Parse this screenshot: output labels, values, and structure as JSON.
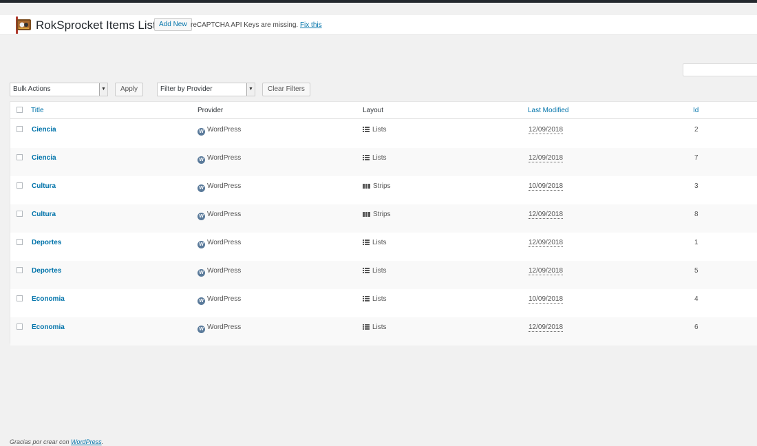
{
  "header": {
    "title": "RokSprocket Items List",
    "add_new_label": "Add New",
    "notice_text": "reCAPTCHA API Keys are missing.",
    "notice_link": "Fix this"
  },
  "toolbar": {
    "bulk_actions": "Bulk Actions",
    "apply_label": "Apply",
    "filter_provider": "Filter by Provider",
    "clear_filters_label": "Clear Filters"
  },
  "table": {
    "columns": {
      "title": "Title",
      "provider": "Provider",
      "layout": "Layout",
      "modified": "Last Modified",
      "id": "Id"
    },
    "rows": [
      {
        "title": "Ciencia",
        "provider": "WordPress",
        "layout": "Lists",
        "layout_icon": "list-icon",
        "modified": "12/09/2018",
        "id": "2"
      },
      {
        "title": "Ciencia",
        "provider": "WordPress",
        "layout": "Lists",
        "layout_icon": "list-icon",
        "modified": "12/09/2018",
        "id": "7"
      },
      {
        "title": "Cultura",
        "provider": "WordPress",
        "layout": "Strips",
        "layout_icon": "strips-icon",
        "modified": "10/09/2018",
        "id": "3"
      },
      {
        "title": "Cultura",
        "provider": "WordPress",
        "layout": "Strips",
        "layout_icon": "strips-icon",
        "modified": "12/09/2018",
        "id": "8"
      },
      {
        "title": "Deportes",
        "provider": "WordPress",
        "layout": "Lists",
        "layout_icon": "list-icon",
        "modified": "12/09/2018",
        "id": "1"
      },
      {
        "title": "Deportes",
        "provider": "WordPress",
        "layout": "Lists",
        "layout_icon": "list-icon",
        "modified": "12/09/2018",
        "id": "5"
      },
      {
        "title": "Economia",
        "provider": "WordPress",
        "layout": "Lists",
        "layout_icon": "list-icon",
        "modified": "10/09/2018",
        "id": "4"
      },
      {
        "title": "Economia",
        "provider": "WordPress",
        "layout": "Lists",
        "layout_icon": "list-icon",
        "modified": "12/09/2018",
        "id": "6"
      }
    ]
  },
  "footer": {
    "text": "Gracias por crear con",
    "link": "WordPress",
    "suffix": "."
  },
  "colors": {
    "link": "#0073aa",
    "admin_bar": "#23282d"
  }
}
